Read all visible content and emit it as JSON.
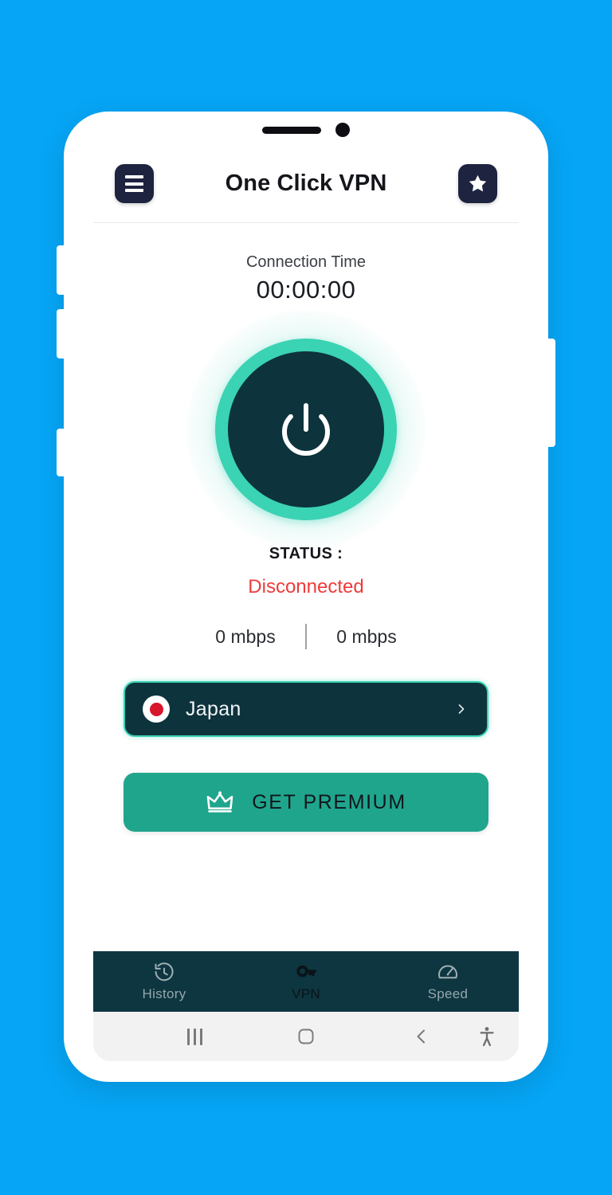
{
  "theme": {
    "background": "#06a5f5",
    "accent_teal": "#3ad3b3",
    "dark_navy": "#1e2340",
    "dark_teal": "#0d333d",
    "nav_bar": "#0d3640",
    "status_red": "#ef3b3b",
    "premium_green": "#20a58d"
  },
  "header": {
    "title": "One Click VPN",
    "menu_icon": "hamburger-menu-icon",
    "favorite_icon": "star-icon"
  },
  "connection": {
    "label": "Connection Time",
    "timer": "00:00:00"
  },
  "power": {
    "icon": "power-icon",
    "state": "off"
  },
  "status": {
    "label": "STATUS :",
    "value": "Disconnected"
  },
  "speeds": {
    "download": "0 mbps",
    "upload": "0 mbps"
  },
  "country": {
    "name": "Japan",
    "flag_icon": "japan-flag-icon",
    "chevron_icon": "chevron-right-icon"
  },
  "premium": {
    "label": "GET PREMIUM",
    "icon": "crown-icon"
  },
  "bottom_nav": {
    "tabs": [
      {
        "label": "History",
        "icon": "history-clock-icon",
        "active": false
      },
      {
        "label": "VPN",
        "icon": "key-icon",
        "active": true
      },
      {
        "label": "Speed",
        "icon": "speedometer-icon",
        "active": false
      }
    ]
  },
  "system_nav": {
    "recents_icon": "recents-icon",
    "home_icon": "home-square-icon",
    "back_icon": "back-chevron-icon",
    "accessibility_icon": "accessibility-icon"
  }
}
